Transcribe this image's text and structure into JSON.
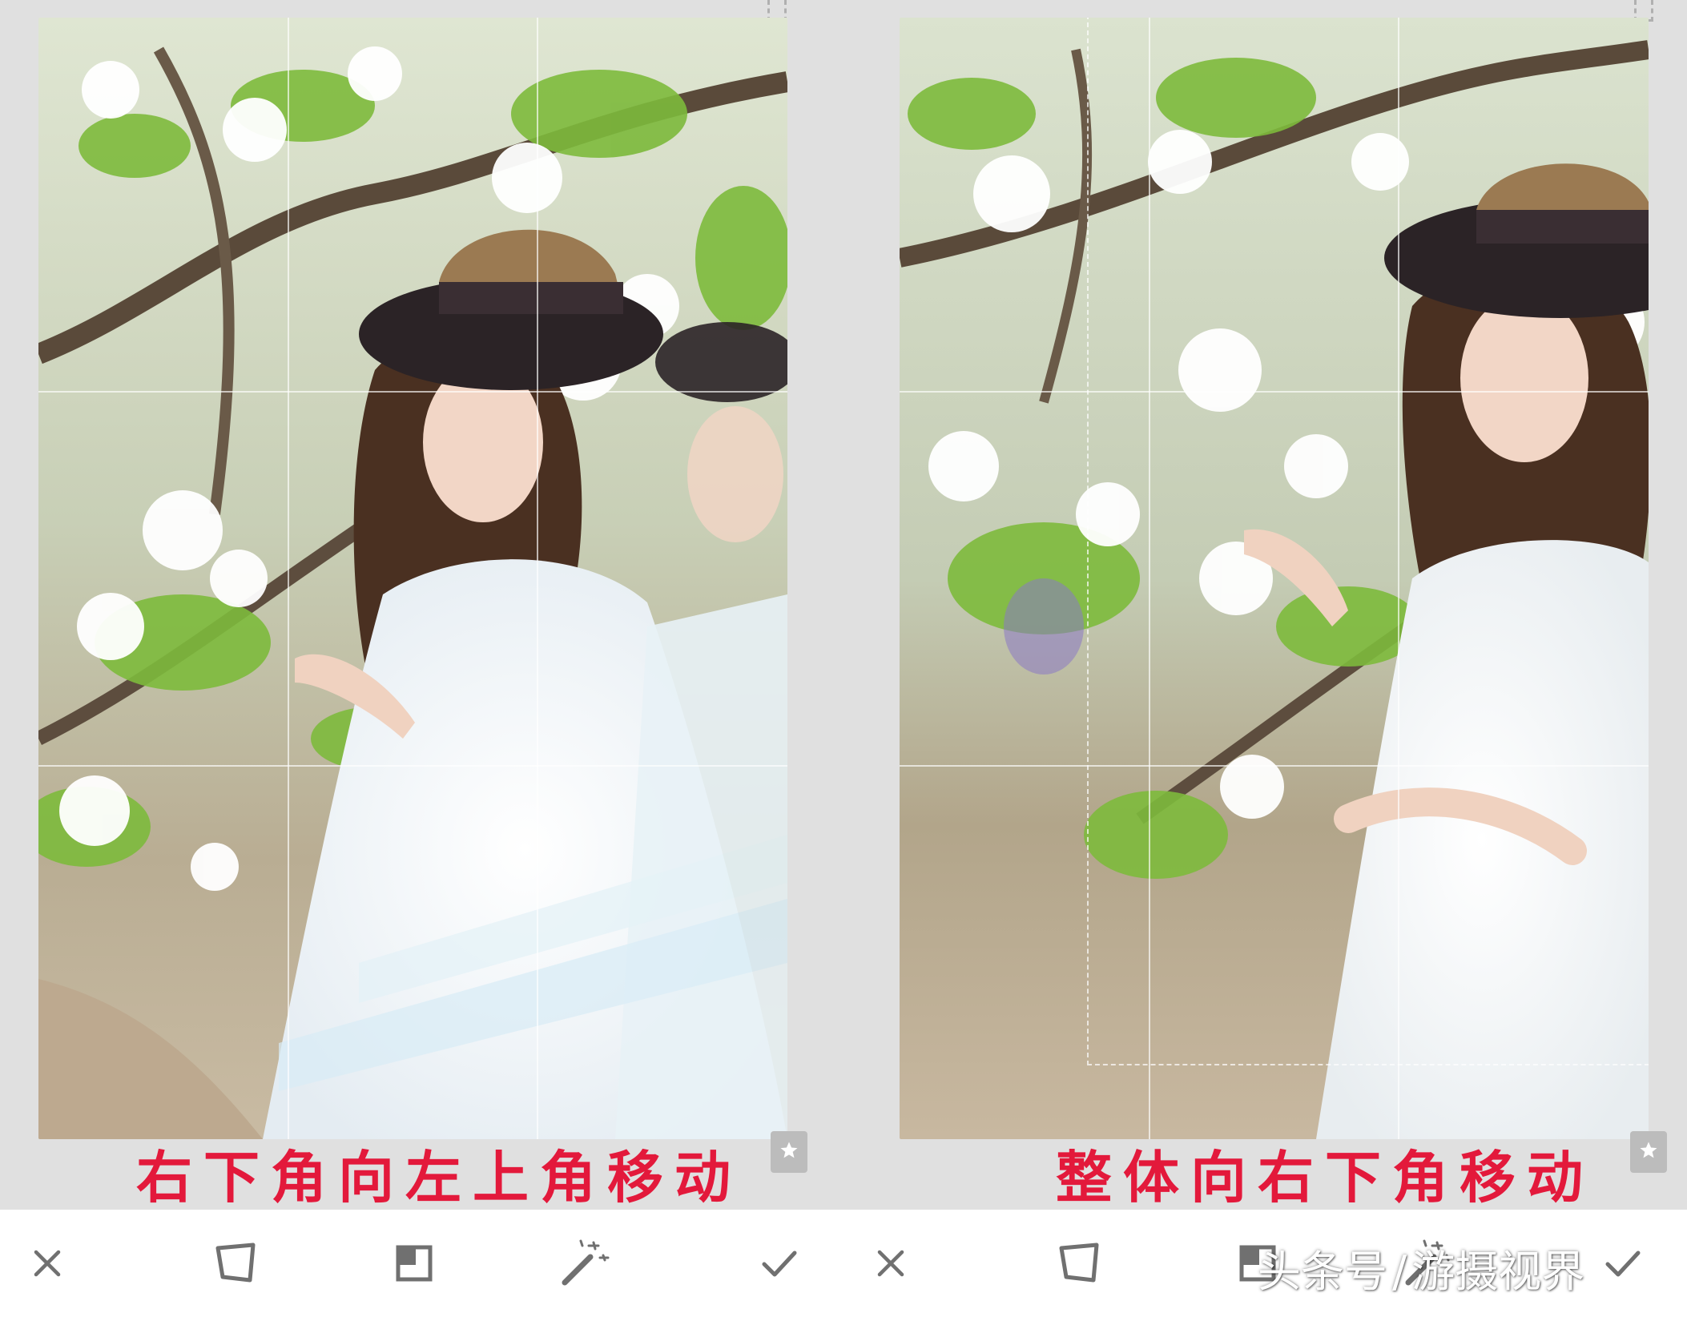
{
  "panels": [
    {
      "id": "left",
      "caption": "右下角向左上角移动",
      "toolbar": {
        "cancel_icon": "close-icon",
        "perspective_icon": "perspective-tool-icon",
        "crop_icon": "expand-frame-icon",
        "auto_icon": "magic-wand-icon",
        "apply_icon": "check-icon"
      }
    },
    {
      "id": "right",
      "caption": "整体向右下角移动",
      "toolbar": {
        "cancel_icon": "close-icon",
        "perspective_icon": "perspective-tool-icon",
        "crop_icon": "expand-frame-icon",
        "auto_icon": "magic-wand-icon",
        "apply_icon": "check-icon"
      }
    }
  ],
  "watermark": {
    "prefix": "头条号",
    "name": "游摄视界"
  },
  "colors": {
    "caption": "#e3193b",
    "toolbar_bg": "#ffffff",
    "icon": "#707070",
    "work_bg": "#e0e0e0"
  }
}
